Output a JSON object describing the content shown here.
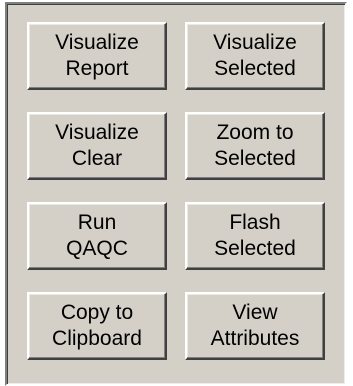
{
  "buttons": [
    {
      "line1": "Visualize",
      "line2": "Report"
    },
    {
      "line1": "Visualize",
      "line2": "Selected"
    },
    {
      "line1": "Visualize",
      "line2": "Clear"
    },
    {
      "line1": "Zoom to",
      "line2": "Selected"
    },
    {
      "line1": "Run",
      "line2": "QAQC"
    },
    {
      "line1": "Flash",
      "line2": "Selected"
    },
    {
      "line1": "Copy to",
      "line2": "Clipboard"
    },
    {
      "line1": "View",
      "line2": "Attributes"
    }
  ]
}
